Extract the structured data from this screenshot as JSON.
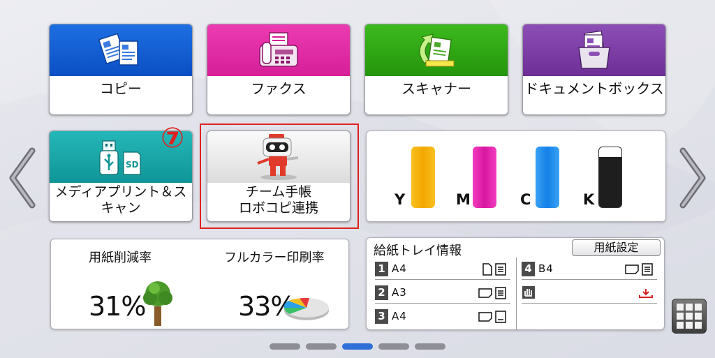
{
  "apps": [
    {
      "label": "コピー",
      "icon": "copy-icon",
      "color": "#0b4fc4"
    },
    {
      "label": "ファクス",
      "icon": "fax-icon",
      "color": "#d61f99"
    },
    {
      "label": "スキャナー",
      "icon": "scanner-icon",
      "color": "#24950c"
    },
    {
      "label": "ドキュメントボックス",
      "icon": "document-box-icon",
      "color": "#6d2e96"
    },
    {
      "label_line1": "メディアプリント＆ス",
      "label_line2": "キャン",
      "icon": "usb-sd-icon",
      "color": "#0f9597"
    },
    {
      "label_line1": "チーム手帳",
      "label_line2": "ロボコピ連携",
      "icon": "robot-icon"
    }
  ],
  "annotation": {
    "step_marker": "⑦"
  },
  "toner": {
    "items": [
      {
        "letter": "Y",
        "color": "#f5b800"
      },
      {
        "letter": "M",
        "color": "#e81cae"
      },
      {
        "letter": "C",
        "color": "#1e8ff0"
      },
      {
        "letter": "K",
        "color": "#2a2a2a"
      }
    ]
  },
  "eco": {
    "paper_reduction_label": "用紙削減率",
    "paper_reduction_value": "31%",
    "full_color_label": "フルカラー印刷率",
    "full_color_value": "33%"
  },
  "tray": {
    "title": "給紙トレイ情報",
    "settings_button": "用紙設定",
    "left_rows": [
      {
        "num": "1",
        "size": "A4"
      },
      {
        "num": "2",
        "size": "A3"
      },
      {
        "num": "3",
        "size": "A4"
      }
    ],
    "right_rows": [
      {
        "num": "4",
        "size": "B4"
      }
    ]
  },
  "pagination": {
    "total": 5,
    "active_index": 2
  }
}
